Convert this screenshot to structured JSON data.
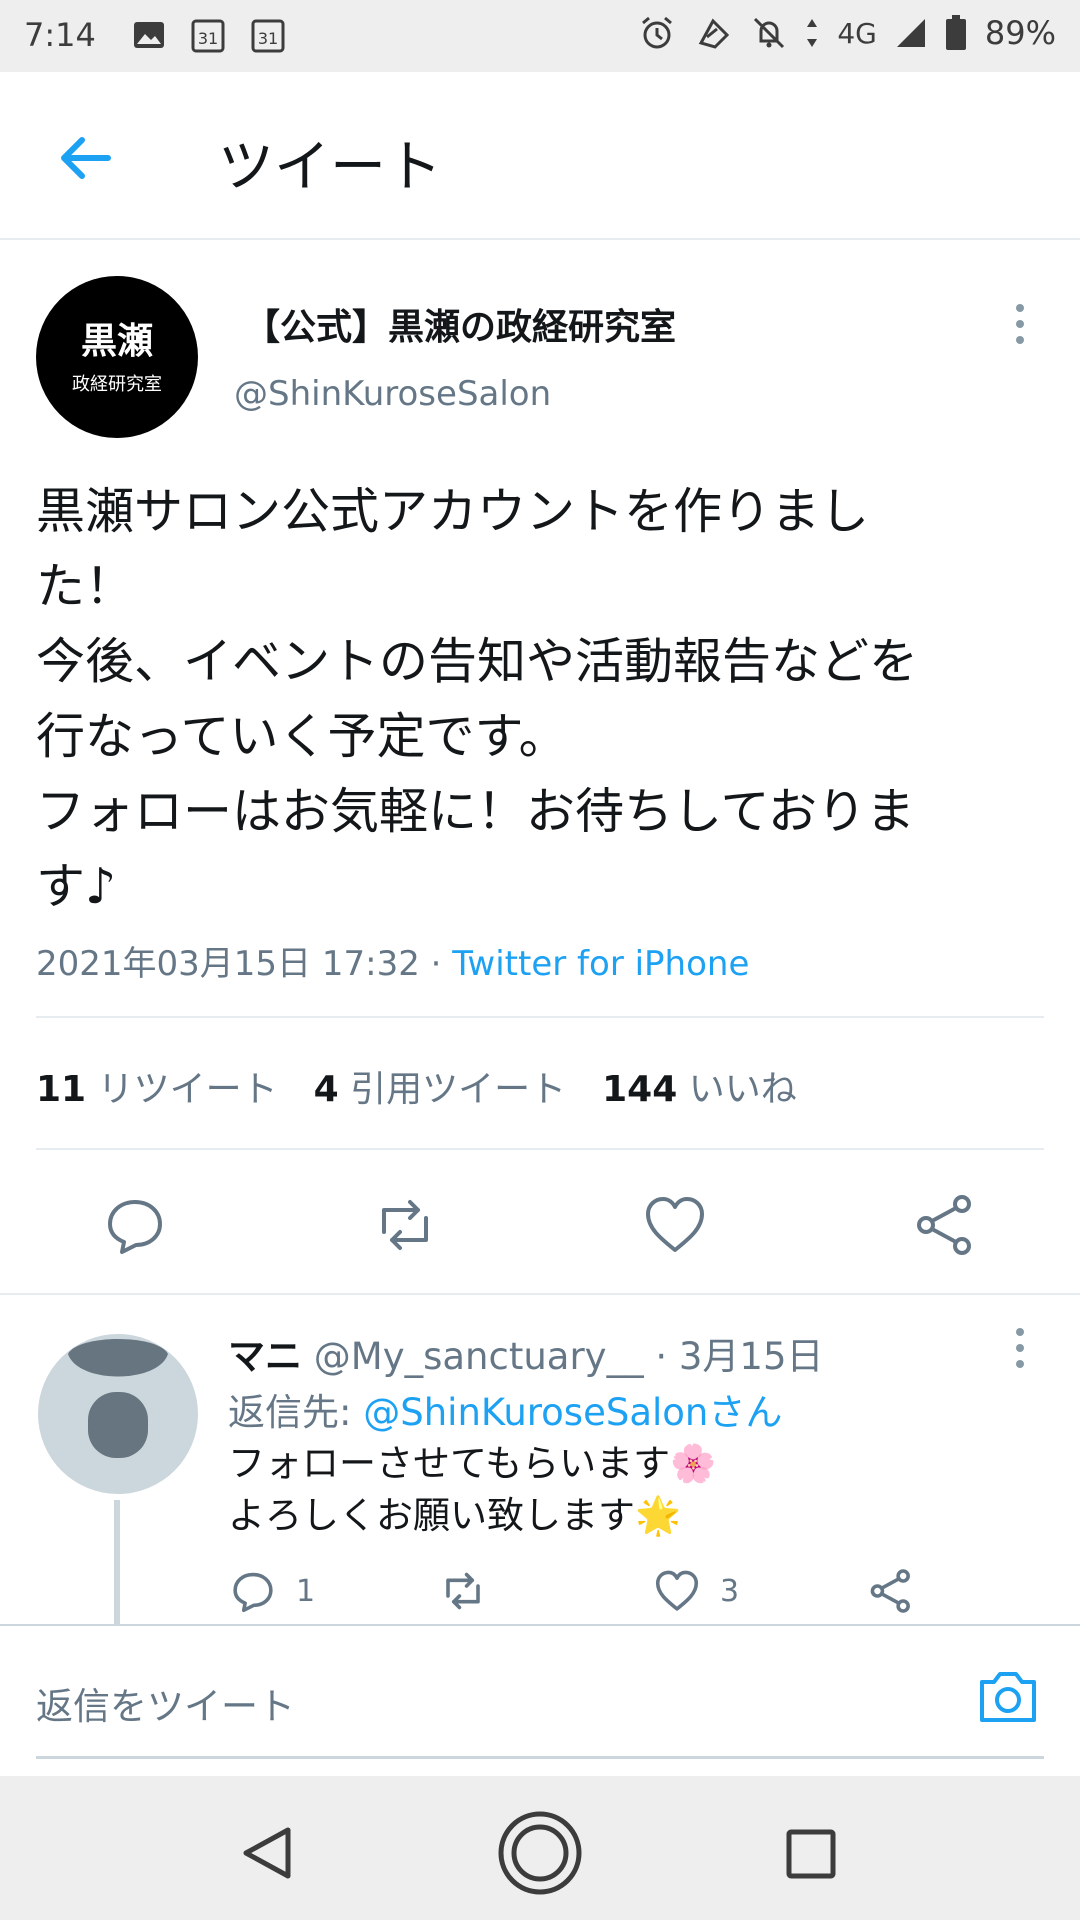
{
  "status_bar": {
    "time": "7:14",
    "network": "4G",
    "battery": "89%",
    "calendar_day": "31"
  },
  "header": {
    "title": "ツイート"
  },
  "tweet": {
    "author_name": "【公式】黒瀬の政経研究室",
    "author_handle": "@ShinKuroseSalon",
    "avatar_text_big": "黒瀬",
    "avatar_text_small": "政経研究室",
    "text": "黒瀬サロン公式アカウントを作りまし\nた！\n今後、イベントの告知や活動報告などを\n行なっていく予定です。\nフォローはお気軽に！お待ちしておりま\nす♪",
    "timestamp": "2021年03月15日 17:32 · ",
    "source": "Twitter for iPhone",
    "stats": {
      "retweets_count": "11",
      "retweets_label": "リツイート",
      "quotes_count": "4",
      "quotes_label": "引用ツイート",
      "likes_count": "144",
      "likes_label": "いいね"
    }
  },
  "reply": {
    "name": "マニ",
    "handle": "@My_sanctuary__",
    "date": "· 3月15日",
    "reply_to_label": "返信先: ",
    "reply_to_handle": "@ShinKuroseSalonさん",
    "text": "フォローさせてもらいます🌸\nよろしくお願い致します🌟",
    "reply_count": "1",
    "like_count": "3"
  },
  "compose": {
    "placeholder": "返信をツイート"
  },
  "colors": {
    "accent": "#1da1f2",
    "secondary_text": "#657786",
    "divider": "#e6ecf0"
  }
}
